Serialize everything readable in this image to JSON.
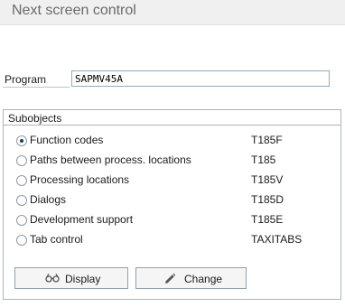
{
  "window": {
    "title": "Next screen control"
  },
  "program": {
    "label": "Program",
    "value": "SAPMV45A"
  },
  "subobjects": {
    "title": "Subobjects",
    "selected_index": 0,
    "options": [
      {
        "label": "Function codes",
        "table": "T185F"
      },
      {
        "label": "Paths between process. locations",
        "table": "T185"
      },
      {
        "label": "Processing locations",
        "table": "T185V"
      },
      {
        "label": "Dialogs",
        "table": "T185D"
      },
      {
        "label": "Development support",
        "table": "T185E"
      },
      {
        "label": "Tab control",
        "table": "TAXITABS"
      }
    ]
  },
  "buttons": {
    "display": {
      "label": "Display",
      "icon": "glasses-icon"
    },
    "change": {
      "label": "Change",
      "icon": "pencil-icon"
    }
  }
}
